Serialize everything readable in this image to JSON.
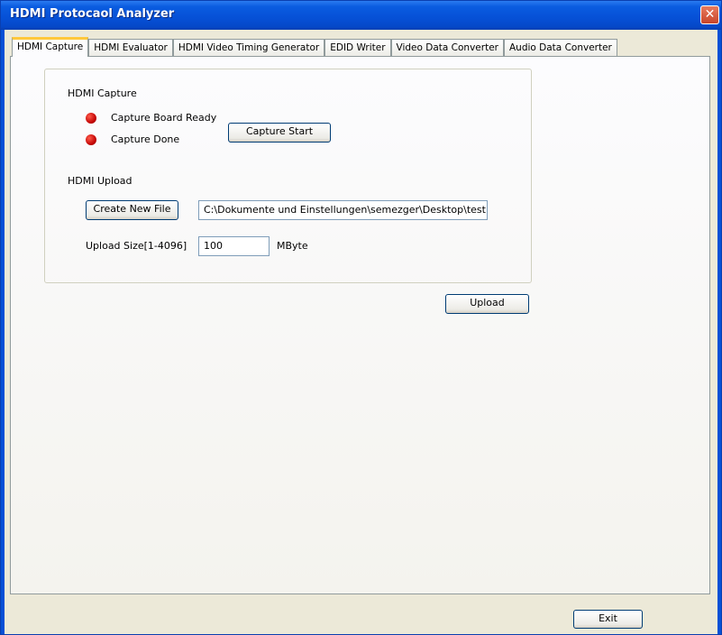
{
  "window": {
    "title": "HDMI Protocaol Analyzer",
    "close_glyph": "✕"
  },
  "tabs": [
    {
      "label": "HDMI Capture",
      "active": true
    },
    {
      "label": "HDMI Evaluator"
    },
    {
      "label": "HDMI Video Timing Generator"
    },
    {
      "label": "EDID Writer"
    },
    {
      "label": "Video Data Converter"
    },
    {
      "label": "Audio Data Converter"
    }
  ],
  "capture": {
    "section_title": "HDMI Capture",
    "status_board_ready": "Capture Board Ready",
    "status_done": "Capture Done",
    "start_button": "Capture Start",
    "led_color": "#cc0000"
  },
  "upload": {
    "section_title": "HDMI Upload",
    "create_file_button": "Create New File",
    "file_path": "C:\\Dokumente und Einstellungen\\semezger\\Desktop\\test.bin",
    "size_label": "Upload Size[1-4096]",
    "size_value": "100",
    "size_unit": "MByte",
    "upload_button": "Upload"
  },
  "footer": {
    "exit_button": "Exit"
  }
}
